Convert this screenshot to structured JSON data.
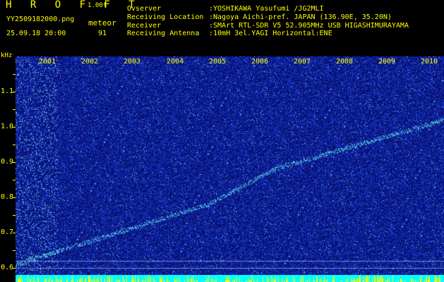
{
  "header": {
    "brand": "H R O F F T",
    "version": "1.00f",
    "image_name": "YY2509182000.png",
    "date": "25.09.18 20:00",
    "meteor_label": "meteor",
    "meteor_count": "91"
  },
  "info": [
    {
      "label": "Ovserver",
      "value": ":YOSHIKAWA Yasufumi /JG2MLI"
    },
    {
      "label": "Receiving Location",
      "value": ":Nagoya Aichi-pref. JAPAN (136.90E, 35.20N)"
    },
    {
      "label": "Receiver",
      "value": ":SMArt RTL-SDR V5 52.905MHz USB HIGASHIMURAYAMA"
    },
    {
      "label": "Receiving Antenna",
      "value": ":10mH 3el.YAGI Horizontal:ENE"
    }
  ],
  "axis": {
    "unit": "kHz",
    "y_ticks": [
      "1.1",
      "1.0",
      "0.9",
      "0.8",
      "0.7",
      "0.6"
    ],
    "x_ticks": [
      "2001",
      "2002",
      "2003",
      "2004",
      "2005",
      "2006",
      "2007",
      "2008",
      "2009",
      "2010"
    ]
  },
  "colors": {
    "background": "#0a1580",
    "noise": "#3355ff",
    "trace": "#66ffff",
    "text": "#ffff00"
  }
}
